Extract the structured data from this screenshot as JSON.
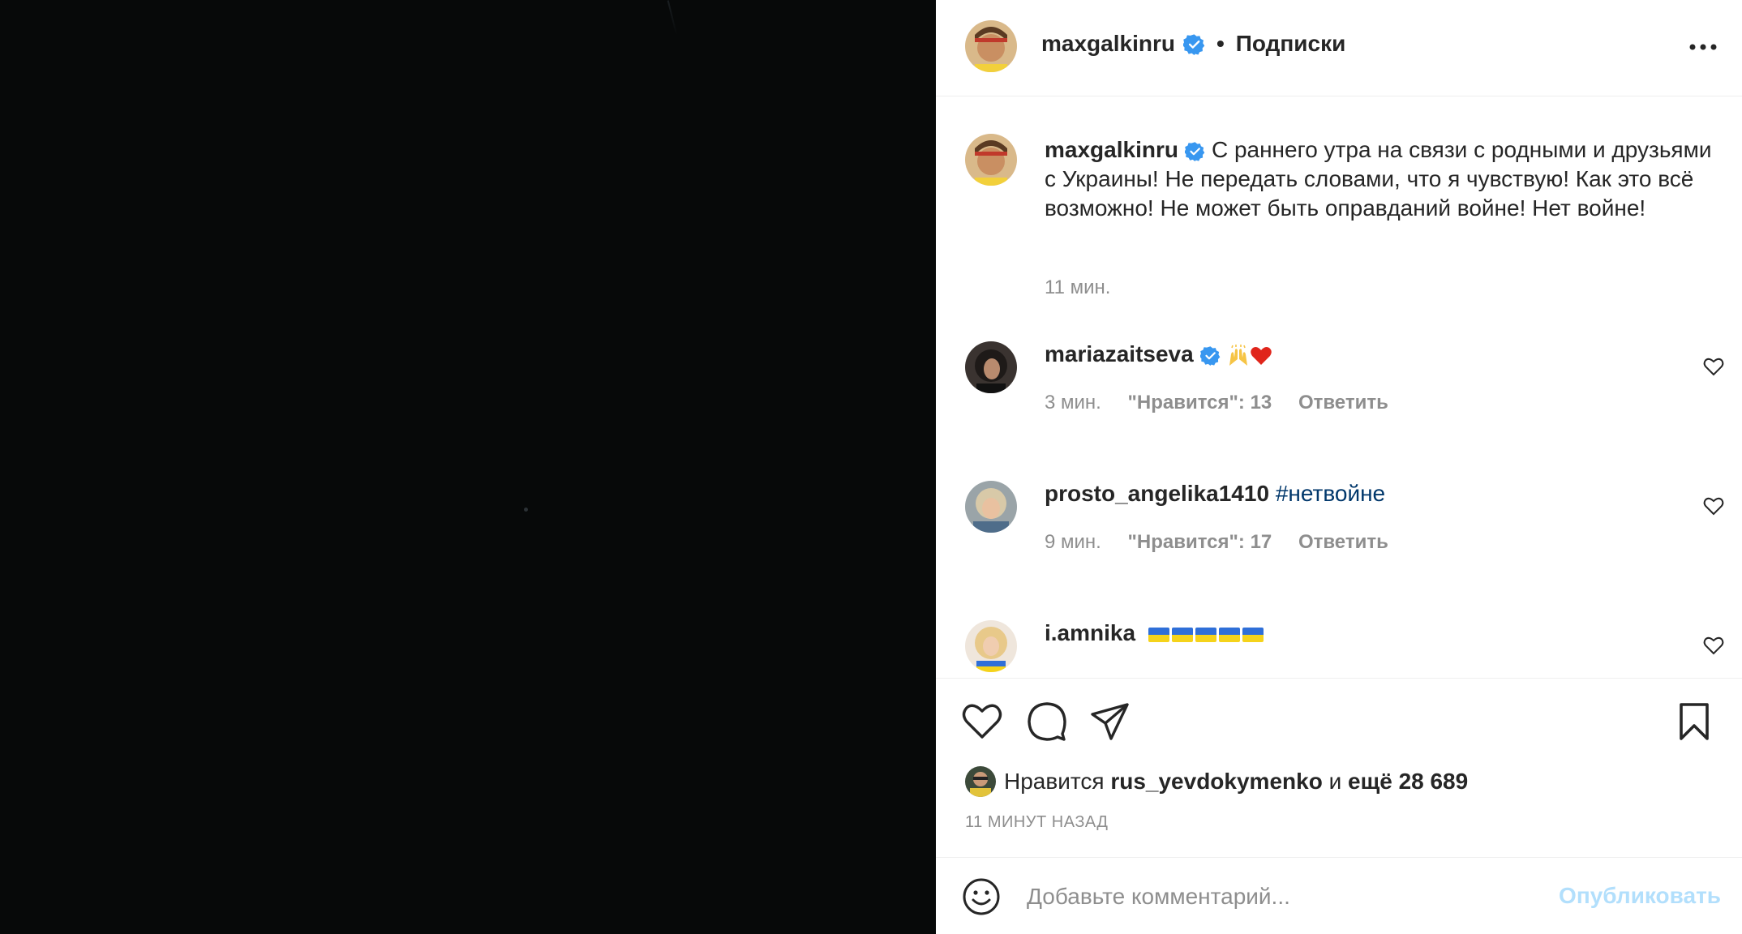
{
  "header": {
    "username": "maxgalkinru",
    "separator": "•",
    "follow_label": "Подписки",
    "more_icon": "more-icon"
  },
  "caption": {
    "username": "maxgalkinru",
    "text": "С раннего утра на связи с родными и друзьями с Украины! Не передать словами, что я чувствую! Как это всё возможно! Не может быть оправданий войне! Нет войне!",
    "time": "11 мин."
  },
  "comments": [
    {
      "username": "mariazaitseva",
      "verified": true,
      "emoji": [
        "🙌",
        "❤️"
      ],
      "time": "3 мин.",
      "likes": "\"Нравится\": 13",
      "reply": "Ответить"
    },
    {
      "username": "prosto_angelika1410",
      "verified": false,
      "text": "#нетвойне",
      "time": "9 мин.",
      "likes": "\"Нравится\": 17",
      "reply": "Ответить"
    },
    {
      "username": "i.amnika",
      "verified": false,
      "flags": [
        "🇺🇦",
        "🇺🇦",
        "🇺🇦",
        "🇺🇦",
        "🇺🇦"
      ]
    }
  ],
  "likes": {
    "prefix": "Нравится",
    "user": "rus_yevdokymenko",
    "connector": "и",
    "rest": "ещё 28 689"
  },
  "timestamp": "11 МИНУТ НАЗАД",
  "add_comment": {
    "placeholder": "Добавьте комментарий...",
    "publish_label": "Опубликовать"
  },
  "colors": {
    "media_background": "#070909",
    "verified_blue": "#3897f0",
    "publish_disabled": "#b2dffc",
    "hashtag": "#00376b",
    "secondary_text": "#8e8e8e"
  }
}
